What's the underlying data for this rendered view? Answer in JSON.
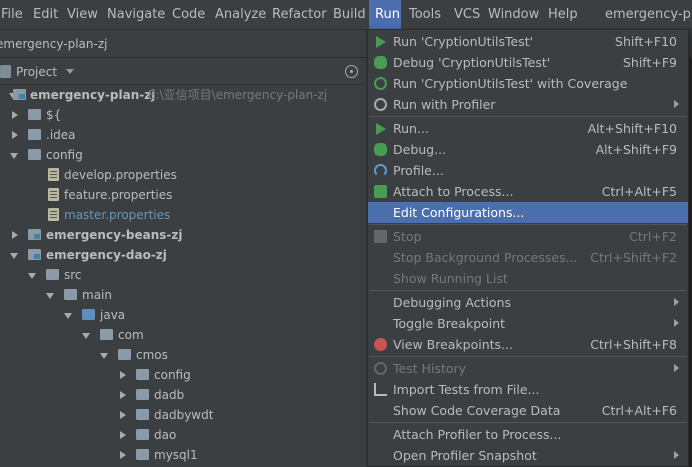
{
  "menubar": {
    "items": [
      "File",
      "Edit",
      "View",
      "Navigate",
      "Code",
      "Analyze",
      "Refactor",
      "Build",
      "Run",
      "Tools",
      "VCS",
      "Window",
      "Help"
    ],
    "window_title": "emergency-pla"
  },
  "breadcrumb": "emergency-plan-zj",
  "project_panel": {
    "title": "Project"
  },
  "tree": [
    {
      "label": "emergency-plan-zj",
      "hint": "E:\\亚信项目\\emergency-plan-zj",
      "bold": true,
      "expanded": true,
      "icon": "module-folder-icon"
    },
    {
      "label": "${",
      "expanded": false,
      "icon": "folder-icon"
    },
    {
      "label": ".idea",
      "expanded": false,
      "icon": "folder-icon"
    },
    {
      "label": "config",
      "expanded": true,
      "icon": "folder-icon"
    },
    {
      "label": "develop.properties",
      "icon": "properties-file-icon"
    },
    {
      "label": "feature.properties",
      "icon": "properties-file-icon"
    },
    {
      "label": "master.properties",
      "icon": "properties-file-icon",
      "highlight": true
    },
    {
      "label": "emergency-beans-zj",
      "bold": true,
      "expanded": false,
      "icon": "module-folder-icon"
    },
    {
      "label": "emergency-dao-zj",
      "bold": true,
      "expanded": true,
      "icon": "module-folder-icon"
    },
    {
      "label": "src",
      "expanded": true,
      "icon": "folder-icon"
    },
    {
      "label": "main",
      "expanded": true,
      "icon": "folder-icon"
    },
    {
      "label": "java",
      "expanded": true,
      "icon": "source-folder-icon"
    },
    {
      "label": "com",
      "expanded": true,
      "icon": "package-icon"
    },
    {
      "label": "cmos",
      "expanded": true,
      "icon": "package-icon"
    },
    {
      "label": "config",
      "expanded": false,
      "icon": "package-icon"
    },
    {
      "label": "dadb",
      "expanded": false,
      "icon": "package-icon"
    },
    {
      "label": "dadbywdt",
      "expanded": false,
      "icon": "package-icon"
    },
    {
      "label": "dao",
      "expanded": false,
      "icon": "package-icon"
    },
    {
      "label": "mysql1",
      "expanded": false,
      "icon": "package-icon"
    }
  ],
  "run_menu": {
    "items": [
      {
        "label": "Run 'CryptionUtilsTest'",
        "shortcut": "Shift+F10",
        "icon": "run-icon"
      },
      {
        "label": "Debug 'CryptionUtilsTest'",
        "shortcut": "Shift+F9",
        "icon": "debug-icon"
      },
      {
        "label": "Run 'CryptionUtilsTest' with Coverage",
        "shortcut": "",
        "icon": "coverage-icon"
      },
      {
        "label": "Run with Profiler",
        "shortcut": "",
        "icon": "profiler-icon",
        "submenu": true
      },
      {
        "label": "Run...",
        "shortcut": "Alt+Shift+F10",
        "icon": "run-icon"
      },
      {
        "label": "Debug...",
        "shortcut": "Alt+Shift+F9",
        "icon": "debug-icon"
      },
      {
        "label": "Profile...",
        "shortcut": "",
        "icon": "profile-icon"
      },
      {
        "label": "Attach to Process...",
        "shortcut": "Ctrl+Alt+F5",
        "icon": "attach-icon"
      },
      {
        "label": "Edit Configurations...",
        "shortcut": "",
        "icon": "",
        "selected": true
      },
      {
        "label": "Stop",
        "shortcut": "Ctrl+F2",
        "icon": "stop-icon",
        "disabled": true
      },
      {
        "label": "Stop Background Processes...",
        "shortcut": "Ctrl+Shift+F2",
        "icon": "",
        "disabled": true
      },
      {
        "label": "Show Running List",
        "shortcut": "",
        "icon": "",
        "disabled": true
      },
      {
        "label": "Debugging Actions",
        "shortcut": "",
        "icon": "",
        "submenu": true
      },
      {
        "label": "Toggle Breakpoint",
        "shortcut": "",
        "icon": "",
        "submenu": true
      },
      {
        "label": "View Breakpoints...",
        "shortcut": "Ctrl+Shift+F8",
        "icon": "breakpoint-icon"
      },
      {
        "label": "Test History",
        "shortcut": "",
        "icon": "history-icon",
        "submenu": true,
        "disabled": true
      },
      {
        "label": "Import Tests from File...",
        "shortcut": "",
        "icon": "import-icon"
      },
      {
        "label": "Show Code Coverage Data",
        "shortcut": "Ctrl+Alt+F6",
        "icon": ""
      },
      {
        "label": "Attach Profiler to Process...",
        "shortcut": "",
        "icon": ""
      },
      {
        "label": "Open Profiler Snapshot",
        "shortcut": "",
        "icon": "",
        "submenu": true
      }
    ]
  }
}
